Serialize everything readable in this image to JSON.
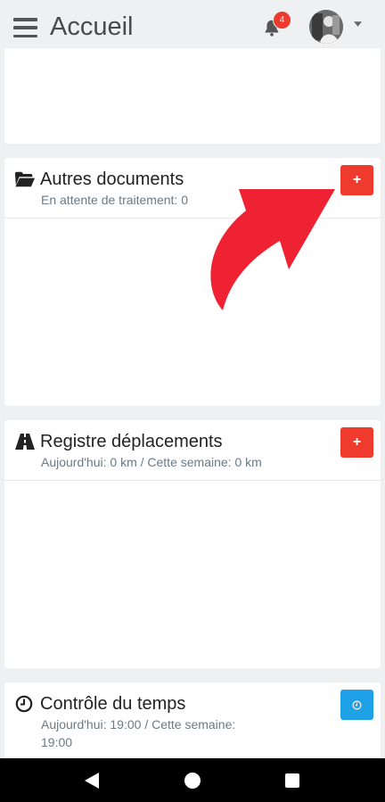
{
  "header": {
    "title": "Accueil",
    "menu_icon": "hamburger-menu-icon",
    "notifications_icon": "bell-icon",
    "notification_count": "4",
    "avatar": "user-avatar",
    "caret_icon": "caret-down-icon"
  },
  "cards": {
    "documents": {
      "icon": "folder-open-icon",
      "title": "Autres documents",
      "subtitle": "En attente de traitement: 0",
      "add_label": "+"
    },
    "trips": {
      "icon": "road-icon",
      "title": "Registre déplacements",
      "subtitle": "Aujourd'hui: 0 km / Cette semaine: 0 km",
      "add_label": "+"
    },
    "time": {
      "icon": "clock-icon",
      "title": "Contrôle du temps",
      "subtitle": "Aujourd'hui: 19:00 / Cette semaine: 19:00",
      "button_icon": "clock-icon"
    }
  },
  "navbar": {
    "back_icon": "back-triangle-icon",
    "home_icon": "home-circle-icon",
    "recent_icon": "recent-apps-square-icon"
  },
  "colors": {
    "background": "#eef0f2",
    "danger": "#ef3b2d",
    "info": "#1ea1e6",
    "arrow": "#ee2233"
  }
}
